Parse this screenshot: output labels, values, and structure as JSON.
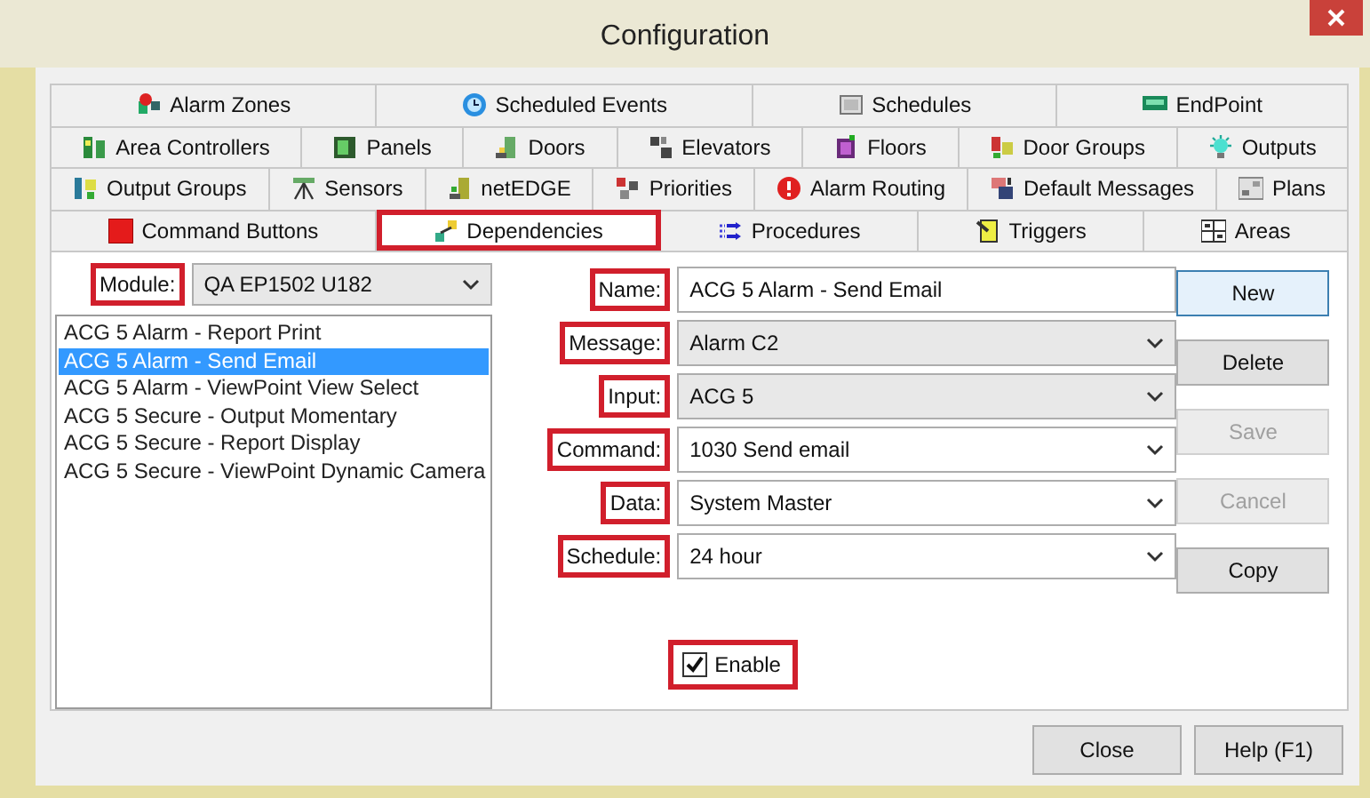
{
  "window": {
    "title": "Configuration"
  },
  "tab_rows": [
    [
      {
        "label": "Alarm Zones",
        "selected": false
      },
      {
        "label": "Scheduled Events",
        "selected": false
      },
      {
        "label": "Schedules",
        "selected": false
      },
      {
        "label": "EndPoint",
        "selected": false
      }
    ],
    [
      {
        "label": "Area Controllers",
        "selected": false
      },
      {
        "label": "Panels",
        "selected": false
      },
      {
        "label": "Doors",
        "selected": false
      },
      {
        "label": "Elevators",
        "selected": false
      },
      {
        "label": "Floors",
        "selected": false
      },
      {
        "label": "Door Groups",
        "selected": false
      },
      {
        "label": "Outputs",
        "selected": false
      }
    ],
    [
      {
        "label": "Output Groups",
        "selected": false
      },
      {
        "label": "Sensors",
        "selected": false
      },
      {
        "label": "netEDGE",
        "selected": false
      },
      {
        "label": "Priorities",
        "selected": false
      },
      {
        "label": "Alarm Routing",
        "selected": false
      },
      {
        "label": "Default Messages",
        "selected": false
      },
      {
        "label": "Plans",
        "selected": false
      }
    ],
    [
      {
        "label": "Command Buttons",
        "selected": false
      },
      {
        "label": "Dependencies",
        "selected": true,
        "highlighted": true
      },
      {
        "label": "Procedures",
        "selected": false
      },
      {
        "label": "Triggers",
        "selected": false
      },
      {
        "label": "Areas",
        "selected": false
      }
    ]
  ],
  "module": {
    "label": "Module:",
    "highlighted": true,
    "value": "QA EP1502 U182"
  },
  "list": [
    {
      "text": "ACG 5 Alarm - Report Print",
      "selected": false
    },
    {
      "text": "ACG 5 Alarm - Send Email",
      "selected": true
    },
    {
      "text": "ACG 5 Alarm - ViewPoint View Select",
      "selected": false
    },
    {
      "text": "ACG 5 Secure - Output Momentary",
      "selected": false
    },
    {
      "text": "ACG 5 Secure - Report Display",
      "selected": false
    },
    {
      "text": "ACG 5 Secure - ViewPoint Dynamic Camera",
      "selected": false
    }
  ],
  "fields": [
    {
      "label": "Name:",
      "highlighted": true,
      "kind": "text",
      "value": "ACG 5 Alarm - Send Email"
    },
    {
      "label": "Message:",
      "highlighted": true,
      "kind": "dropdown",
      "value": "Alarm C2"
    },
    {
      "label": "Input:",
      "highlighted": true,
      "kind": "dropdown",
      "value": "ACG 5"
    },
    {
      "label": "Command:",
      "highlighted": true,
      "kind": "combo",
      "value": "1030 Send email"
    },
    {
      "label": "Data:",
      "highlighted": true,
      "kind": "combo",
      "value": "System Master"
    },
    {
      "label": "Schedule:",
      "highlighted": true,
      "kind": "combo",
      "value": "24 hour"
    }
  ],
  "buttons": [
    {
      "label": "New",
      "default": true,
      "disabled": false
    },
    {
      "label": "Delete",
      "default": false,
      "disabled": false
    },
    {
      "label": "Save",
      "default": false,
      "disabled": true
    },
    {
      "label": "Cancel",
      "default": false,
      "disabled": true
    },
    {
      "label": "Copy",
      "default": false,
      "disabled": false
    }
  ],
  "enable": {
    "label": "Enable",
    "checked": true,
    "highlighted": true
  },
  "footer_buttons": [
    "Close",
    "Help (F1)"
  ]
}
